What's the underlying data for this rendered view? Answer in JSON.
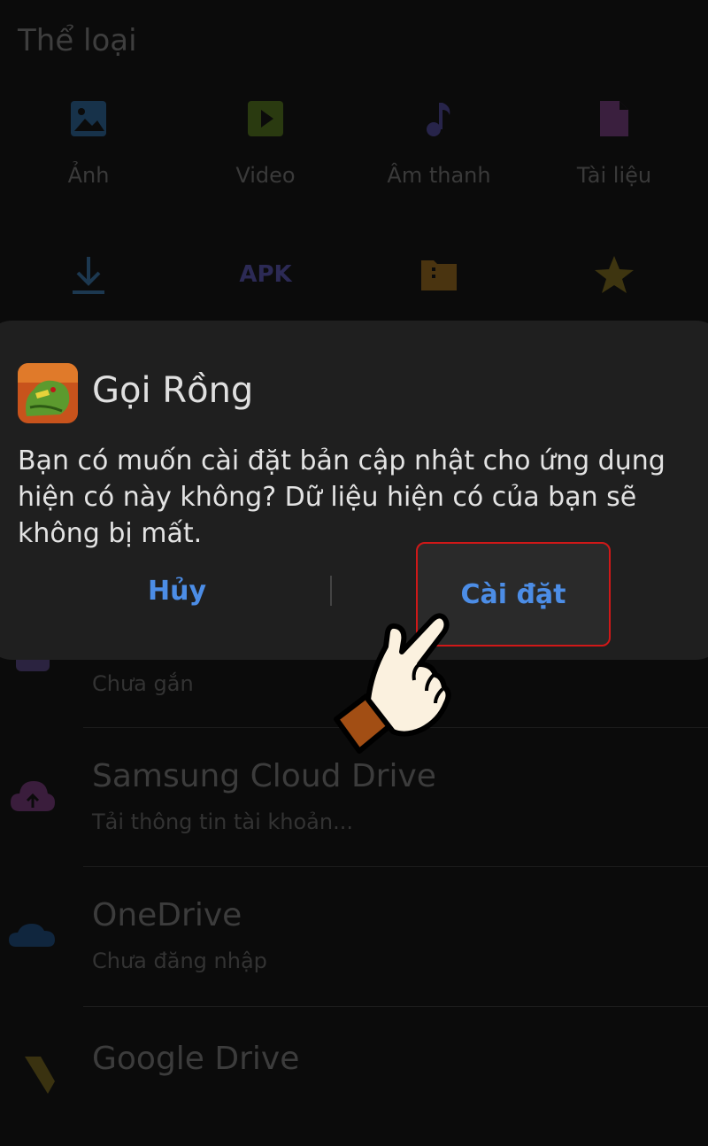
{
  "background": {
    "section_title": "Thể loại",
    "categories": [
      {
        "label": "Ảnh",
        "icon": "image-icon"
      },
      {
        "label": "Video",
        "icon": "video-icon"
      },
      {
        "label": "Âm thanh",
        "icon": "music-icon"
      },
      {
        "label": "Tài liệu",
        "icon": "document-icon"
      }
    ],
    "shortcuts": [
      {
        "icon": "download-icon"
      },
      {
        "label": "APK",
        "icon": "apk-icon"
      },
      {
        "icon": "folder-icon"
      },
      {
        "icon": "star-icon"
      }
    ],
    "storage_rows": [
      {
        "title": "",
        "subtitle": "Chưa gắn",
        "icon": "sd-card-icon"
      },
      {
        "title": "Samsung Cloud Drive",
        "subtitle": "Tải thông tin tài khoản...",
        "icon": "cloud-upload-icon"
      },
      {
        "title": "OneDrive",
        "subtitle": "Chưa đăng nhập",
        "icon": "onedrive-icon"
      },
      {
        "title": "Google Drive",
        "subtitle": "",
        "icon": "google-drive-icon"
      }
    ]
  },
  "dialog": {
    "app_name": "Gọi Rồng",
    "message": "Bạn có muốn cài đặt bản cập nhật cho ứng dụng hiện có này không? Dữ liệu hiện có của bạn sẽ không bị mất.",
    "cancel_label": "Hủy",
    "install_label": "Cài đặt"
  },
  "colors": {
    "accent": "#4c8de6",
    "highlight_border": "#d01818",
    "dialog_bg": "#1f1f1f"
  }
}
